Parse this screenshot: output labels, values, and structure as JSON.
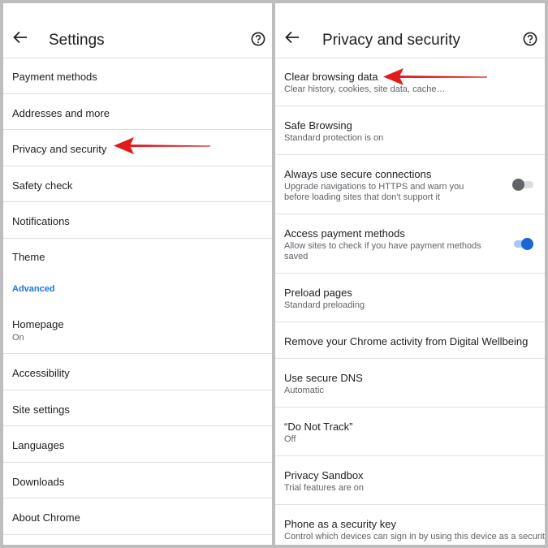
{
  "left": {
    "title": "Settings",
    "items": [
      {
        "label": "Payment methods"
      },
      {
        "label": "Addresses and more"
      },
      {
        "label": "Privacy and security"
      },
      {
        "label": "Safety check"
      },
      {
        "label": "Notifications"
      },
      {
        "label": "Theme"
      }
    ],
    "section": "Advanced",
    "advanced_items": [
      {
        "label": "Homepage",
        "sub": "On"
      },
      {
        "label": "Accessibility"
      },
      {
        "label": "Site settings"
      },
      {
        "label": "Languages"
      },
      {
        "label": "Downloads"
      },
      {
        "label": "About Chrome"
      }
    ]
  },
  "right": {
    "title": "Privacy and security",
    "items": [
      {
        "label": "Clear browsing data",
        "sub": "Clear history, cookies, site data, cache…"
      },
      {
        "label": "Safe Browsing",
        "sub": "Standard protection is on"
      },
      {
        "label": "Always use secure connections",
        "sub": "Upgrade navigations to HTTPS and warn you before loading sites that don’t support it",
        "toggle": "off"
      },
      {
        "label": "Access payment methods",
        "sub": "Allow sites to check if you have payment methods saved",
        "toggle": "on"
      },
      {
        "label": "Preload pages",
        "sub": "Standard preloading"
      },
      {
        "label": "Remove your Chrome activity from Digital Wellbeing"
      },
      {
        "label": "Use secure DNS",
        "sub": "Automatic"
      },
      {
        "label": "“Do Not Track”",
        "sub": "Off"
      },
      {
        "label": "Privacy Sandbox",
        "sub": "Trial features are on"
      },
      {
        "label": "Phone as a security key",
        "sub": "Control which devices can sign in by using this device as a security key"
      }
    ]
  },
  "colors": {
    "accent": "#1a73e8",
    "annotation_arrow": "#e01b1b"
  }
}
